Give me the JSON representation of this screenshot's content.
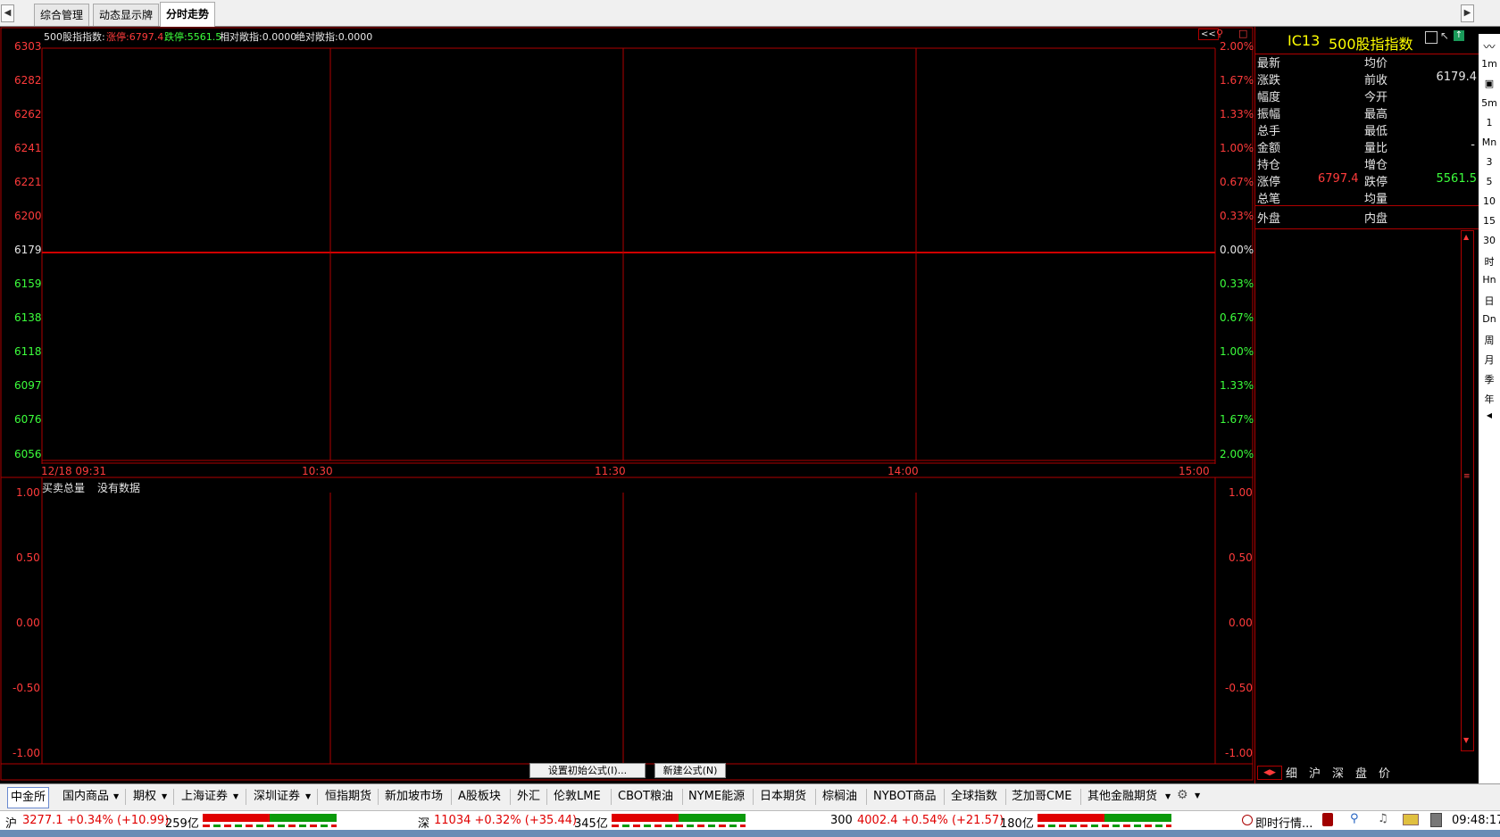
{
  "top_tabs": [
    "综合管理",
    "动态显示牌",
    "分时走势"
  ],
  "nav": {
    "left_arrow": "◀",
    "right_arrow": "▶"
  },
  "chart_header": {
    "title": "500股指指数:",
    "limit_up_label": "涨停:6797.4",
    "limit_down_label": "跌停:5561.5",
    "rel_label": "相对敞指:0.0000",
    "abs_label": "绝对敞指:0.0000",
    "collapse_btn": "<<"
  },
  "price_axis": {
    "left_ticks": [
      "6303",
      "6282",
      "6262",
      "6241",
      "6221",
      "6200",
      "6179",
      "6159",
      "6138",
      "6118",
      "6097",
      "6076",
      "6056"
    ],
    "right_ticks": [
      "2.00%",
      "1.67%",
      "1.33%",
      "1.00%",
      "0.67%",
      "0.33%",
      "0.00%",
      "0.33%",
      "0.67%",
      "1.00%",
      "1.33%",
      "1.67%",
      "2.00%"
    ]
  },
  "time_axis": [
    "12/18 09:31",
    "10:30",
    "11:30",
    "14:00",
    "15:00"
  ],
  "volume_panel": {
    "title": "买卖总量",
    "no_data": "没有数据",
    "left_ticks": [
      "1.00",
      "0.50",
      "0.00",
      "-0.50",
      "-1.00"
    ],
    "right_ticks": [
      "1.00",
      "0.50",
      "0.00",
      "-0.50",
      "-1.00"
    ]
  },
  "formula_buttons": {
    "set_initial": "设置初始公式(I)...",
    "new_formula": "新建公式(N)"
  },
  "quote_panel": {
    "code": "IC13",
    "name": "500股指指数",
    "rows": [
      {
        "l": "最新",
        "lv": "",
        "r": "均价",
        "rv": ""
      },
      {
        "l": "涨跌",
        "lv": "",
        "r": "前收",
        "rv": "6179.4"
      },
      {
        "l": "幅度",
        "lv": "",
        "r": "今开",
        "rv": ""
      },
      {
        "l": "振幅",
        "lv": "",
        "r": "最高",
        "rv": ""
      },
      {
        "l": "总手",
        "lv": "",
        "r": "最低",
        "rv": ""
      },
      {
        "l": "金额",
        "lv": "",
        "r": "量比",
        "rv": "-"
      },
      {
        "l": "持仓",
        "lv": "",
        "r": "增仓",
        "rv": ""
      },
      {
        "l": "涨停",
        "lv": "6797.4",
        "r": "跌停",
        "rv": "5561.5"
      },
      {
        "l": "总笔",
        "lv": "",
        "r": "均量",
        "rv": ""
      }
    ],
    "outer": "外盘",
    "inner": "内盘",
    "bottom_tabs": [
      "细",
      "沪",
      "深",
      "盘",
      "价"
    ]
  },
  "vertical_toolbar": [
    "1m",
    "5m",
    "1",
    "Mn",
    "3",
    "5",
    "10",
    "15",
    "30",
    "时",
    "Hn",
    "日",
    "Dn",
    "周",
    "月",
    "季",
    "年"
  ],
  "bottom_tabs": [
    "中金所",
    "国内商品",
    "期权",
    "上海证券",
    "深圳证券",
    "恒指期货",
    "新加坡市场",
    "A股板块",
    "外汇",
    "伦敦LME",
    "CBOT粮油",
    "NYME能源",
    "日本期货",
    "棕榈油",
    "NYBOT商品",
    "全球指数",
    "芝加哥CME",
    "其他金融期货"
  ],
  "status": {
    "sh_label": "沪",
    "sh_value": "3277.1 +0.34% (+10.99)",
    "sh_amount": "259亿",
    "sz_label": "深",
    "sz_value": "11034 +0.32% (+35.44)",
    "sz_amount": "345亿",
    "hs_label": "300",
    "hs_value": "4002.4 +0.54% (+21.57)",
    "hs_amount": "180亿",
    "realtime": "即时行情...",
    "clock": "09:48:17"
  },
  "colors": {
    "up": "#ff3b3b",
    "down": "#3cff3c",
    "grid": "#b00000",
    "name": "#ffff00"
  }
}
